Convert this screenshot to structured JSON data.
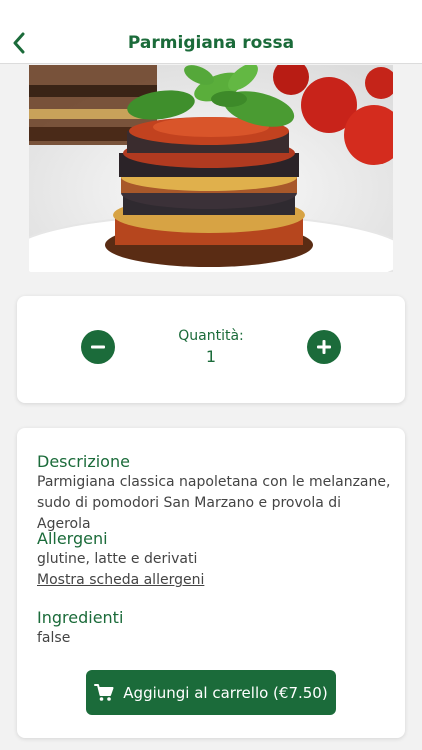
{
  "header": {
    "title": "Parmigiana rossa"
  },
  "quantity": {
    "label": "Quantità:",
    "value": "1"
  },
  "description": {
    "title": "Descrizione",
    "text": "Parmigiana classica napoletana con le melanzane, sudo di pomodori San Marzano e provola di Agerola"
  },
  "allergens": {
    "title": "Allergeni",
    "text": "glutine, latte e derivati",
    "link": "Mostra scheda allergeni"
  },
  "ingredients": {
    "title": "Ingredienti",
    "text": "false"
  },
  "cart": {
    "label": "Aggiungi al carrello (€7.50)"
  },
  "colors": {
    "accent": "#1b6b3a",
    "background": "#f2f2f2",
    "card": "#ffffff"
  }
}
